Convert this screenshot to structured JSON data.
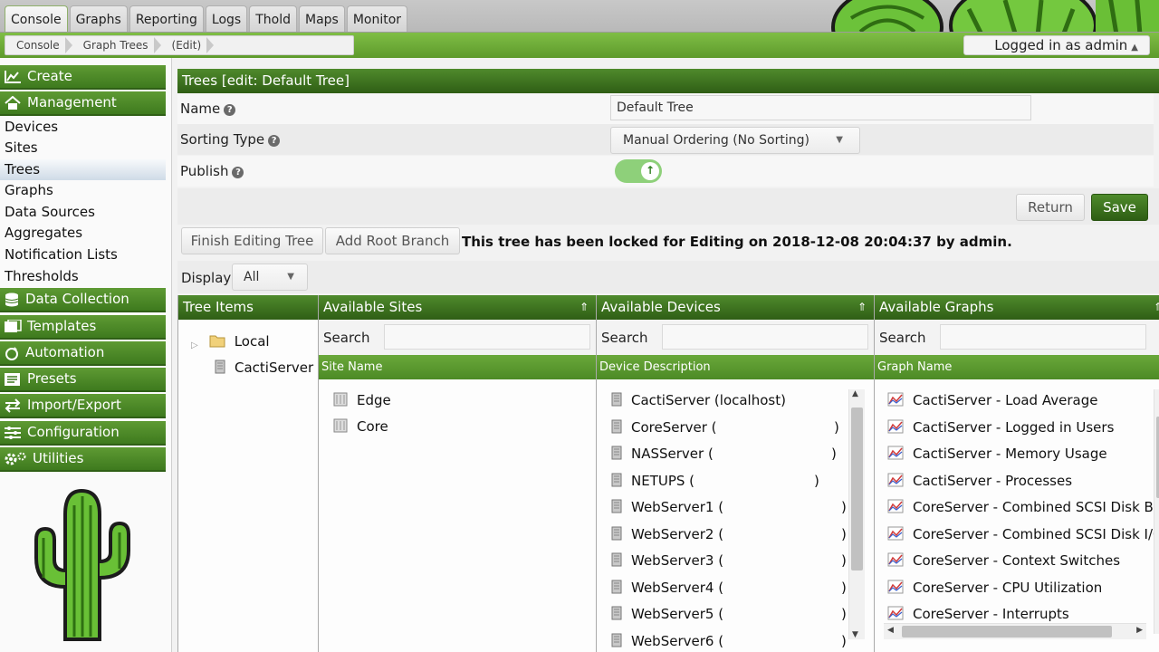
{
  "top_tabs": [
    "Console",
    "Graphs",
    "Reporting",
    "Logs",
    "Thold",
    "Maps",
    "Monitor"
  ],
  "breadcrumbs": [
    "Console",
    "Graph Trees",
    "(Edit)"
  ],
  "user": {
    "label": "Logged in as admin"
  },
  "sidebar": {
    "create": "Create",
    "management": "Management",
    "management_items": [
      "Devices",
      "Sites",
      "Trees",
      "Graphs",
      "Data Sources",
      "Aggregates",
      "Notification Lists",
      "Thresholds"
    ],
    "sections": [
      "Data Collection",
      "Templates",
      "Automation",
      "Presets",
      "Import/Export",
      "Configuration",
      "Utilities"
    ]
  },
  "form": {
    "title": "Trees [edit: Default Tree]",
    "name_label": "Name",
    "name_value": "Default Tree",
    "sorting_label": "Sorting Type",
    "sorting_value": "Manual Ordering (No Sorting)",
    "publish_label": "Publish"
  },
  "buttons": {
    "return": "Return",
    "save": "Save",
    "finish_editing": "Finish Editing Tree",
    "add_root_branch": "Add Root Branch"
  },
  "lock_note": "This tree has been locked for Editing on 2018-12-08 20:04:37 by admin.",
  "display": {
    "label": "Display",
    "value": "All"
  },
  "tree_items": {
    "header": "Tree Items",
    "items": [
      "Local",
      "CactiServer"
    ]
  },
  "sites": {
    "header": "Available Sites",
    "search": "Search",
    "column": "Site Name",
    "items": [
      "Edge",
      "Core"
    ]
  },
  "devices": {
    "header": "Available Devices",
    "search": "Search",
    "column": "Device Description",
    "items": [
      "CactiServer (localhost)",
      "CoreServer (",
      "NASServer (",
      "NETUPS (",
      "WebServer1 (",
      "WebServer2 (",
      "WebServer3 (",
      "WebServer4 (",
      "WebServer5 (",
      "WebServer6 ("
    ],
    "close_paren": ")"
  },
  "graphs": {
    "header": "Available Graphs",
    "search": "Search",
    "column": "Graph Name",
    "items": [
      "CactiServer - Load Average",
      "CactiServer - Logged in Users",
      "CactiServer - Memory Usage",
      "CactiServer - Processes",
      "CoreServer - Combined SCSI Disk Byt",
      "CoreServer - Combined SCSI Disk I/O",
      "CoreServer - Context Switches",
      "CoreServer - CPU Utilization",
      "CoreServer - Interrupts"
    ]
  },
  "colors": {
    "accent_green": "#3e7a1e",
    "highlight_green": "#7fbe45",
    "toggle_on": "#8ed07a"
  }
}
